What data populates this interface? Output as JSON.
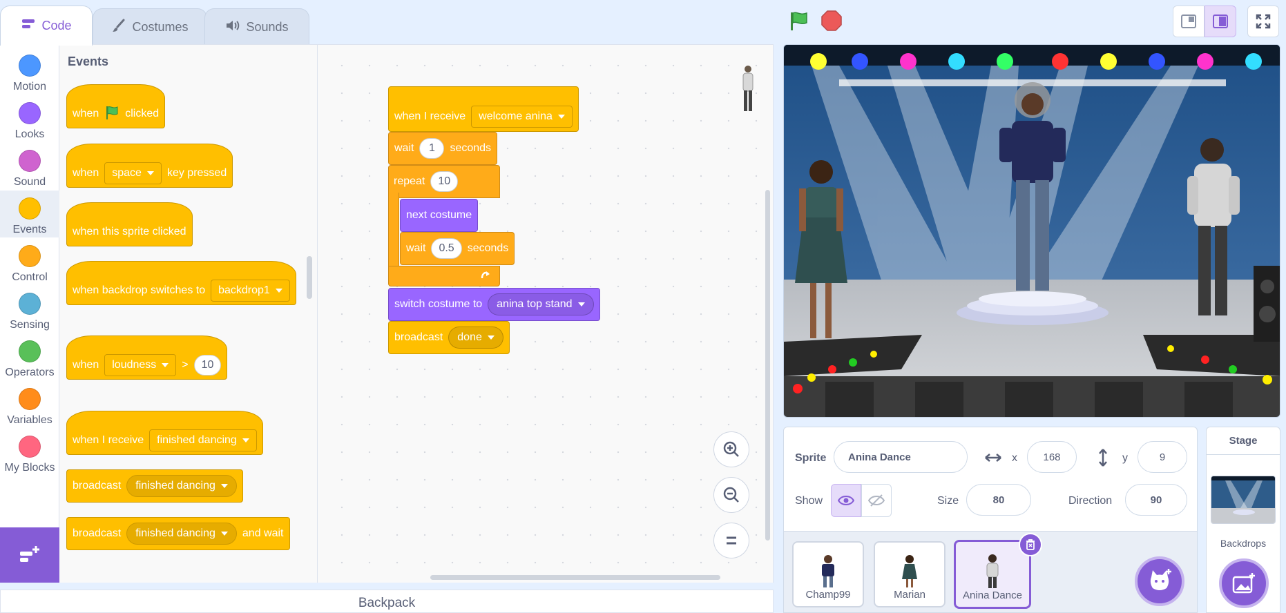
{
  "tabs": [
    {
      "label": "Code",
      "icon": "code-icon",
      "active": true
    },
    {
      "label": "Costumes",
      "icon": "brush-icon",
      "active": false
    },
    {
      "label": "Sounds",
      "icon": "speaker-icon",
      "active": false
    }
  ],
  "categories": [
    {
      "label": "Motion",
      "color": "#4c97ff"
    },
    {
      "label": "Looks",
      "color": "#9966ff"
    },
    {
      "label": "Sound",
      "color": "#cf63cf"
    },
    {
      "label": "Events",
      "color": "#ffbf00",
      "selected": true
    },
    {
      "label": "Control",
      "color": "#ffab19"
    },
    {
      "label": "Sensing",
      "color": "#5cb1d6"
    },
    {
      "label": "Operators",
      "color": "#59c059"
    },
    {
      "label": "Variables",
      "color": "#ff8c1a"
    },
    {
      "label": "My Blocks",
      "color": "#ff6680"
    }
  ],
  "palette": {
    "heading": "Events",
    "when_flag": {
      "when": "when",
      "clicked": "clicked"
    },
    "when_key": {
      "when": "when",
      "key": "space",
      "pressed": "key pressed"
    },
    "sprite_clicked": "when this sprite clicked",
    "backdrop_switch": {
      "text": "when backdrop switches to",
      "value": "backdrop1"
    },
    "when_gt": {
      "when": "when",
      "sensor": "loudness",
      "op": ">",
      "value": "10"
    },
    "when_receive": {
      "text": "when I receive",
      "value": "finished dancing"
    },
    "broadcast": {
      "text": "broadcast",
      "value": "finished dancing"
    },
    "broadcast_wait": {
      "text": "broadcast",
      "value": "finished dancing",
      "suffix": "and wait"
    }
  },
  "script": {
    "receive": {
      "text": "when I receive",
      "value": "welcome anina"
    },
    "wait1": {
      "wait": "wait",
      "value": "1",
      "seconds": "seconds"
    },
    "repeat": {
      "text": "repeat",
      "value": "10"
    },
    "next_costume": "next costume",
    "wait2": {
      "wait": "wait",
      "value": "0.5",
      "seconds": "seconds"
    },
    "switch": {
      "text": "switch costume to",
      "value": "anina top stand"
    },
    "broadcast": {
      "text": "broadcast",
      "value": "done"
    }
  },
  "backpack": "Backpack",
  "sprite_info": {
    "sprite_label": "Sprite",
    "sprite_name": "Anina Dance",
    "x_label": "x",
    "x_value": "168",
    "y_label": "y",
    "y_value": "9",
    "show_label": "Show",
    "size_label": "Size",
    "size_value": "80",
    "direction_label": "Direction",
    "direction_value": "90"
  },
  "sprites": [
    {
      "name": "Champ99",
      "selected": false
    },
    {
      "name": "Marian",
      "selected": false
    },
    {
      "name": "Anina Dance",
      "selected": true
    }
  ],
  "stage_panel": {
    "title": "Stage",
    "backdrops_label": "Backdrops"
  }
}
